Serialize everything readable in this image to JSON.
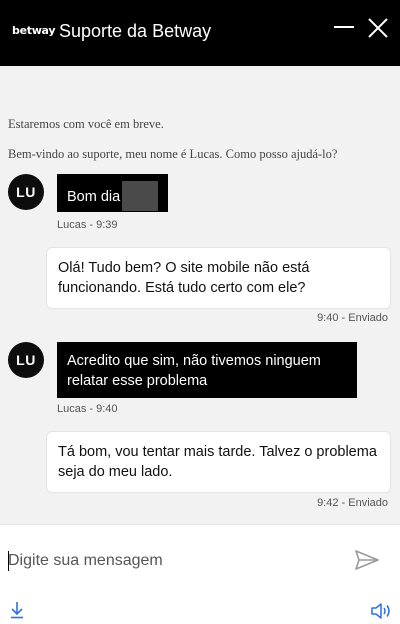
{
  "header": {
    "logo": "betway",
    "title": "Suporte da Betway"
  },
  "system": {
    "notice": "Estaremos com você em breve.",
    "welcome": "Bem-vindo ao suporte, meu nome é Lucas. Como posso ajudá-lo?"
  },
  "messages": [
    {
      "avatar": "LU",
      "text": "Bom dia",
      "meta": "Lucas - 9:39"
    },
    {
      "text": "Olá! Tudo bem? O site mobile não está funcionando. Está tudo certo com ele?",
      "meta": "9:40 - Enviado"
    },
    {
      "avatar": "LU",
      "text": "Acredito que sim, não tivemos ninguem relatar esse problema",
      "meta": "Lucas - 9:40"
    },
    {
      "text": "Tá bom, vou tentar mais tarde. Talvez o problema seja do meu lado.",
      "meta": "9:42 - Enviado"
    }
  ],
  "composer": {
    "placeholder": "Digite sua mensagem",
    "value": ""
  },
  "icons": {
    "minimize": "minimize-icon",
    "close": "close-icon",
    "send": "send-icon",
    "download": "download-icon",
    "sound": "volume-icon"
  },
  "colors": {
    "header_bg": "#000000",
    "agent_bubble_bg": "#000000",
    "user_bubble_bg": "#ffffff",
    "chat_bg": "#f2f2f2",
    "accent_icon": "#2f6fe0"
  }
}
